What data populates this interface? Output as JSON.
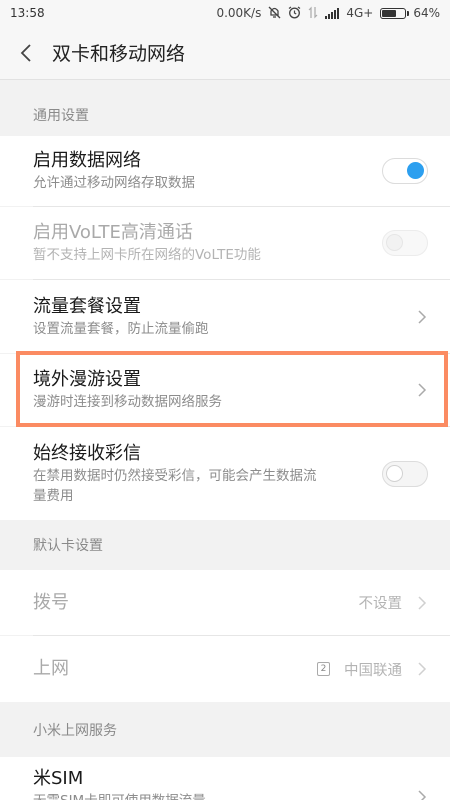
{
  "status_bar": {
    "time": "13:58",
    "network_speed": "0.00K/s",
    "icons": [
      "mute-icon",
      "alarm-icon",
      "data-transfer-icon",
      "signal-icon"
    ],
    "network_type": "4G+",
    "battery": "64%",
    "battery_level": 0.64
  },
  "header": {
    "title": "双卡和移动网络"
  },
  "sections": {
    "general": "通用设置",
    "default_card": "默认卡设置",
    "xiaomi_service": "小米上网服务"
  },
  "rows": {
    "data_network": {
      "title": "启用数据网络",
      "subtitle": "允许通过移动网络存取数据",
      "enabled": true
    },
    "volte": {
      "title": "启用VoLTE高清通话",
      "subtitle": "暂不支持上网卡所在网络的VoLTE功能",
      "enabled": false
    },
    "data_plan": {
      "title": "流量套餐设置",
      "subtitle": "设置流量套餐，防止流量偷跑"
    },
    "roaming": {
      "title": "境外漫游设置",
      "subtitle": "漫游时连接到移动数据网络服务"
    },
    "mms": {
      "title": "始终接收彩信",
      "subtitle_line1": "在禁用数据时仍然接受彩信，可能会产生数据流",
      "subtitle_line2": "量费用",
      "enabled": false
    },
    "dial": {
      "title": "拨号",
      "value": "不设置"
    },
    "internet": {
      "title": "上网",
      "sim_slot": "2",
      "value": "中国联通"
    },
    "mi_sim": {
      "title": "米SIM",
      "subtitle": "无需SIM卡即可使用数据流量"
    }
  },
  "colors": {
    "accent": "#2c9fef",
    "highlight": "#fb8b62"
  }
}
